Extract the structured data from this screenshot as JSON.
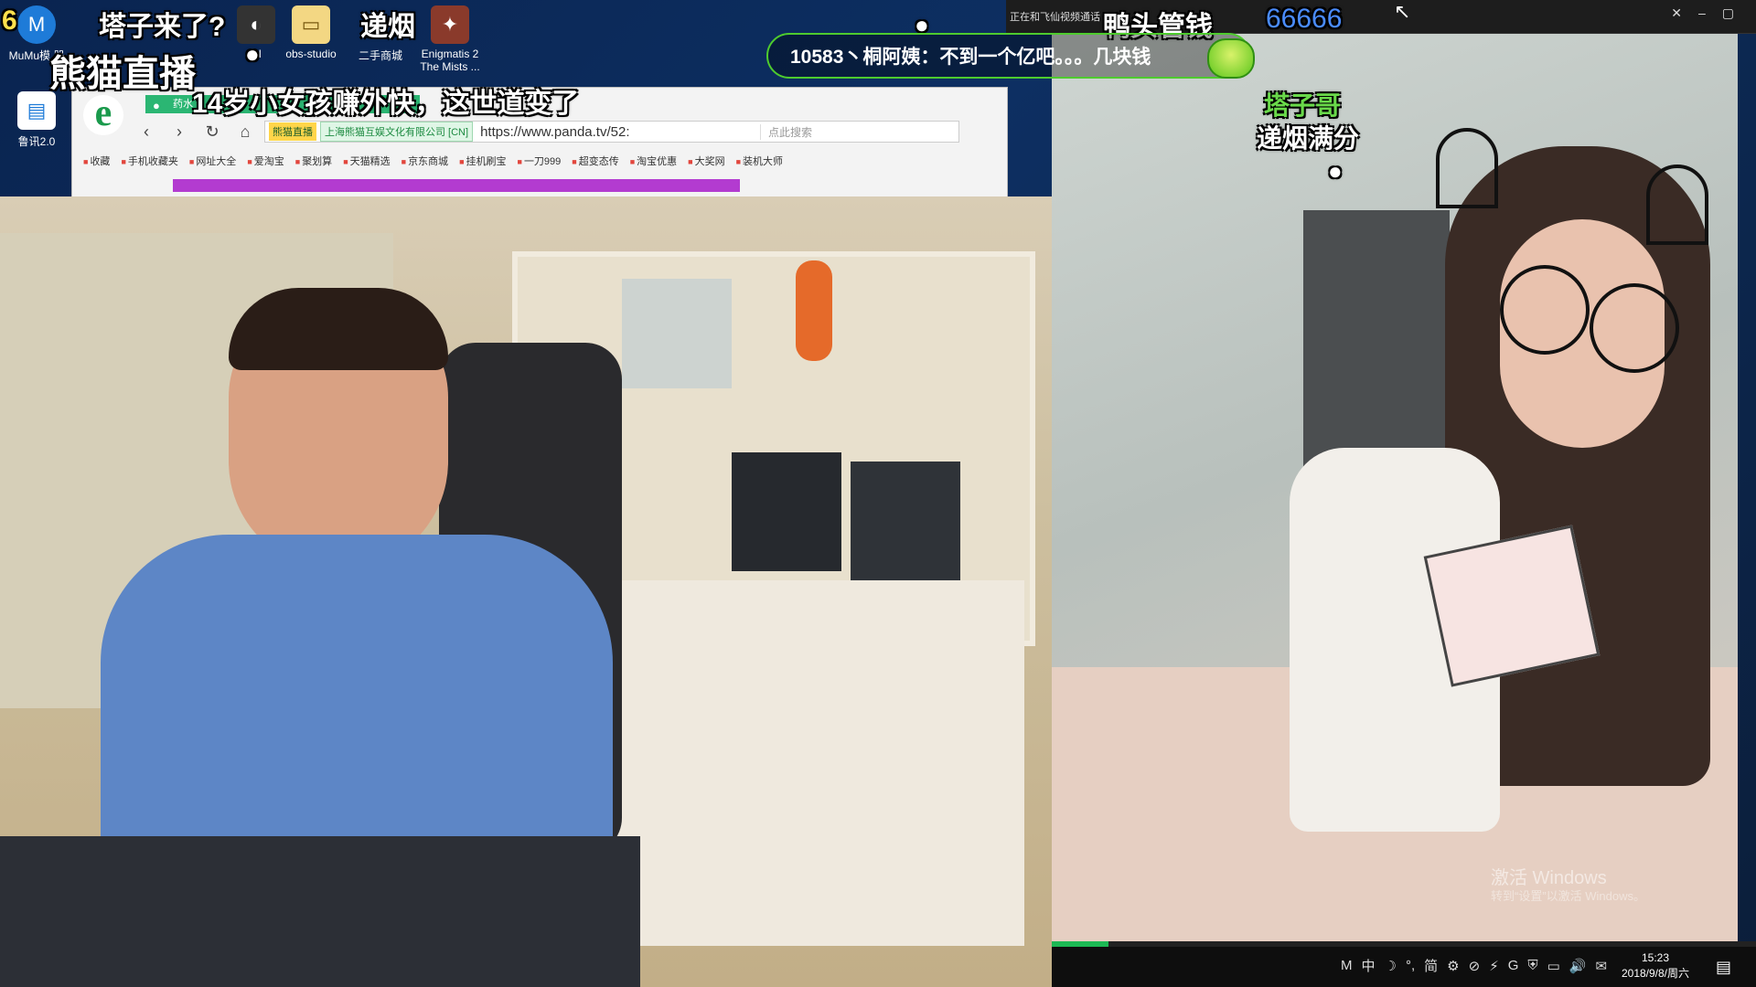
{
  "overlay": {
    "top_left_number": "6",
    "caption_1": "塔子来了?",
    "caption_2": "递烟",
    "stream_logo": "熊猫直播",
    "headline": "14岁小女孩赚外快，这世道变了",
    "top_title": "鸭头管钱",
    "top_number": "66666",
    "comment_name": "塔子哥",
    "comment_text": "递烟满分"
  },
  "desktop_icons": [
    {
      "label": "MuMu模\n器",
      "icon": "app-icon"
    },
    {
      "label": "CI",
      "icon": "app-icon"
    },
    {
      "label": "obs-studio",
      "icon": "folder-icon"
    },
    {
      "label": "二手商城",
      "icon": "app-icon"
    },
    {
      "label": "Enigmatis 2\nThe Mists ...",
      "icon": "game-icon"
    },
    {
      "label": "鲁讯2.0",
      "icon": "document-icon"
    }
  ],
  "browser": {
    "tab_label": "药水",
    "url": "https://www.panda.tv/52:",
    "site_badge": "熊猫直播",
    "company_badge": "上海熊猫互娱文化有限公司 [CN]",
    "search_placeholder": "点此搜索",
    "bookmarks": [
      "收藏",
      "手机收藏夹",
      "网址大全",
      "爱淘宝",
      "聚划算",
      "天猫精选",
      "京东商城",
      "挂机刷宝",
      "一刀999",
      "超变态传",
      "淘宝优惠",
      "大奖网",
      "装机大师"
    ]
  },
  "stream_window": {
    "title": "正在和飞仙视频通话"
  },
  "chat": {
    "message": "10583丶桐阿姨：不到一个亿吧。。。几块钱"
  },
  "watermark": {
    "line1": "激活 Windows",
    "line2": "转到“设置”以激活 Windows。"
  },
  "taskbar": {
    "time": "15:23",
    "date": "2018/9/8/周六",
    "progress": 0.08,
    "tray_icons": [
      "M",
      "中",
      "☽",
      "°,",
      "简",
      "⚙",
      "⊘",
      "⚡",
      "G",
      "⛨",
      "▭",
      "🔊",
      "✉"
    ]
  },
  "colors": {
    "chat_border": "#4ecb2e",
    "comment_name": "#69d94a",
    "top_number": "#4a8cff"
  }
}
